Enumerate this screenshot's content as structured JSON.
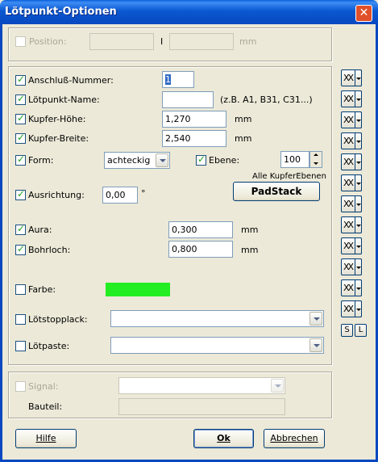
{
  "window": {
    "title": "Lötpunkt-Optionen",
    "close_glyph": "✕"
  },
  "position": {
    "label": "Position:",
    "x_value": "",
    "y_value": "",
    "separator": "I",
    "unit": "mm"
  },
  "fields": {
    "anschluss": {
      "label": "Anschluß-Nummer:",
      "value": "1",
      "checked": true
    },
    "name": {
      "label": "Lötpunkt-Name:",
      "value": "",
      "hint": "(z.B. A1, B31, C31...)",
      "checked": true
    },
    "hoehe": {
      "label": "Kupfer-Höhe:",
      "value": "1,270",
      "unit": "mm",
      "checked": true
    },
    "breite": {
      "label": "Kupfer-Breite:",
      "value": "2,540",
      "unit": "mm",
      "checked": true
    },
    "form": {
      "label": "Form:",
      "value": "achteckig",
      "checked": true
    },
    "ebene": {
      "label": "Ebene:",
      "value": "100",
      "checked": true,
      "note": "Alle KupferEbenen"
    },
    "padstack": {
      "label": "PadStack"
    },
    "ausrichtung": {
      "label": "Ausrichtung:",
      "value": "0,00",
      "unit": "°",
      "checked": true
    },
    "aura": {
      "label": "Aura:",
      "value": "0,300",
      "unit": "mm",
      "checked": true
    },
    "bohrloch": {
      "label": "Bohrloch:",
      "value": "0,800",
      "unit": "mm",
      "checked": true
    },
    "farbe": {
      "label": "Farbe:",
      "checked": false,
      "color": "#22ee22"
    },
    "loetstopp": {
      "label": "Lötstopplack:",
      "value": "",
      "checked": false
    },
    "loetpaste": {
      "label": "Lötpaste:",
      "value": "",
      "checked": false
    }
  },
  "signal": {
    "label": "Signal:",
    "value": "",
    "bauteil_label": "Bauteil:",
    "bauteil_value": ""
  },
  "sidebar": {
    "btn_glyph": "XX",
    "count": 12,
    "s_label": "S",
    "l_label": "L"
  },
  "buttons": {
    "help": "Hilfe",
    "ok": "Ok",
    "cancel": "Abbrechen"
  }
}
